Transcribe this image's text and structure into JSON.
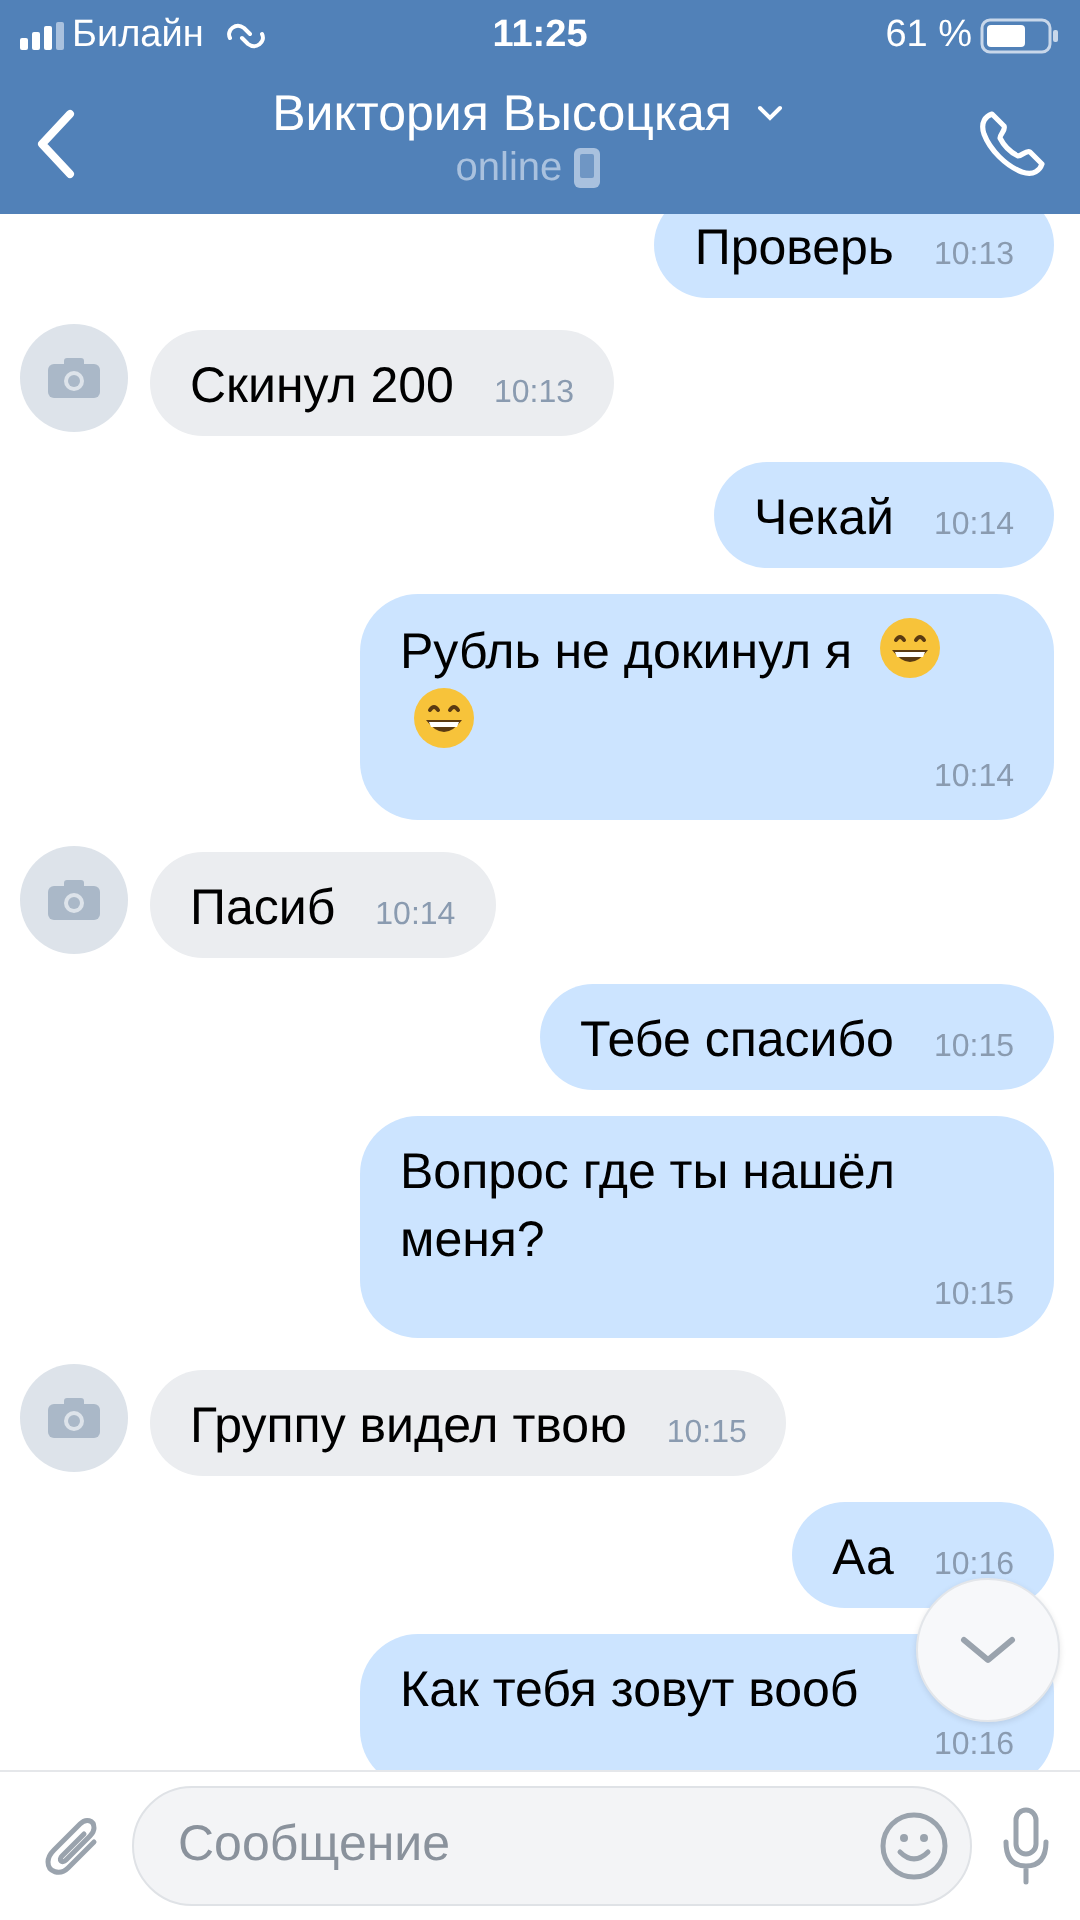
{
  "status_bar": {
    "carrier": "Билайн",
    "time": "11:25",
    "battery": "61 %"
  },
  "header": {
    "title": "Виктория Высоцкая",
    "status": "online"
  },
  "messages": [
    {
      "outgoing": true,
      "text": "Проверь",
      "time": "10:13",
      "trailing_emoji": false
    },
    {
      "outgoing": false,
      "text": "Скинул 200",
      "time": "10:13",
      "trailing_emoji": false
    },
    {
      "outgoing": true,
      "text": "Чекай",
      "time": "10:14",
      "trailing_emoji": false
    },
    {
      "outgoing": true,
      "text": "Рубль не докинул я",
      "time": "10:14",
      "trailing_emoji": true
    },
    {
      "outgoing": false,
      "text": "Пасиб",
      "time": "10:14",
      "trailing_emoji": false
    },
    {
      "outgoing": true,
      "text": "Тебе спасибо",
      "time": "10:15",
      "trailing_emoji": false
    },
    {
      "outgoing": true,
      "text": "Вопрос где ты нашёл меня?",
      "time": "10:15",
      "trailing_emoji": false
    },
    {
      "outgoing": false,
      "text": "Группу видел твою",
      "time": "10:15",
      "trailing_emoji": false
    },
    {
      "outgoing": true,
      "text": "Аа",
      "time": "10:16",
      "trailing_emoji": false
    },
    {
      "outgoing": true,
      "text": "Как тебя зовут вооб",
      "time": "10:16",
      "trailing_emoji": false
    }
  ],
  "composer": {
    "placeholder": "Сообщение"
  }
}
